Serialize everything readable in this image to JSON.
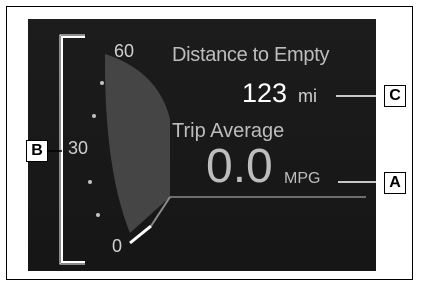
{
  "gauge": {
    "scale_max": "60",
    "scale_mid": "30",
    "scale_min": "0",
    "level_fraction": 0.05
  },
  "distance_to_empty": {
    "label": "Distance to Empty",
    "value": "123",
    "unit": "mi"
  },
  "trip_average": {
    "label": "Trip Average",
    "value": "0.0",
    "unit": "MPG"
  },
  "callouts": {
    "a": "A",
    "b": "B",
    "c": "C"
  },
  "colors": {
    "screen_bg": "#1c1c1c",
    "gauge_fill": "#4a4a4a",
    "needle": "#ffffff"
  }
}
